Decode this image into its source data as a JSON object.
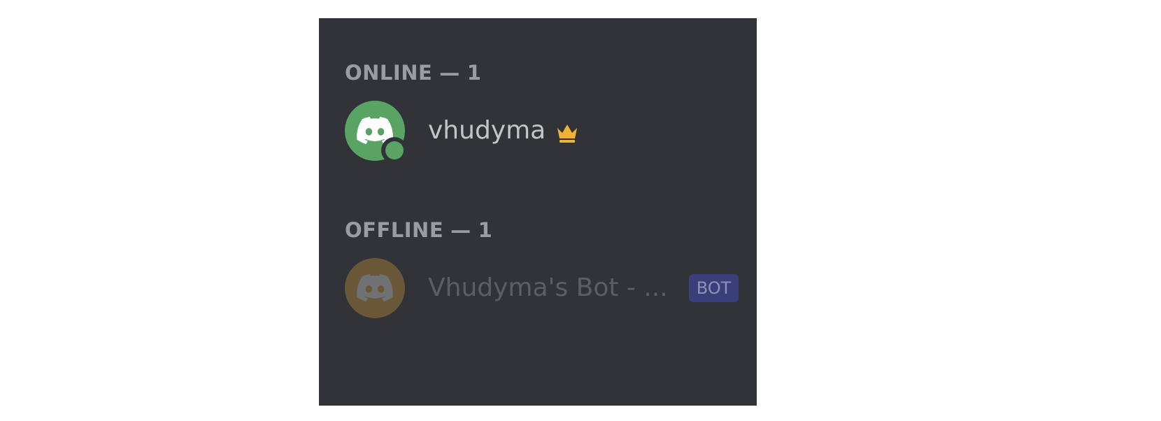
{
  "online_section": {
    "label": "ONLINE",
    "separator": "—",
    "count": "1",
    "members": [
      {
        "name": "vhudyma",
        "avatar_color": "#5aa463",
        "status_color": "#5aa463",
        "status": "online",
        "name_color": "#c4c5c9",
        "badge_icon": "crown-icon",
        "badge_color": "#f0b232"
      }
    ]
  },
  "offline_section": {
    "label": "OFFLINE",
    "separator": "—",
    "count": "1",
    "members": [
      {
        "name": "Vhudyma's Bot - ...",
        "avatar_color": "#7a6136",
        "status": "offline",
        "name_color": "#5c5e64",
        "tag": "BOT",
        "tag_color": "#3a3f7a"
      }
    ]
  },
  "colors": {
    "panel_bg": "#313338",
    "header_text": "#9a9ca3",
    "page_bg": "#ffffff"
  },
  "icons": {
    "avatar_glyph": "discord-logo-icon",
    "owner_badge": "crown-icon"
  }
}
